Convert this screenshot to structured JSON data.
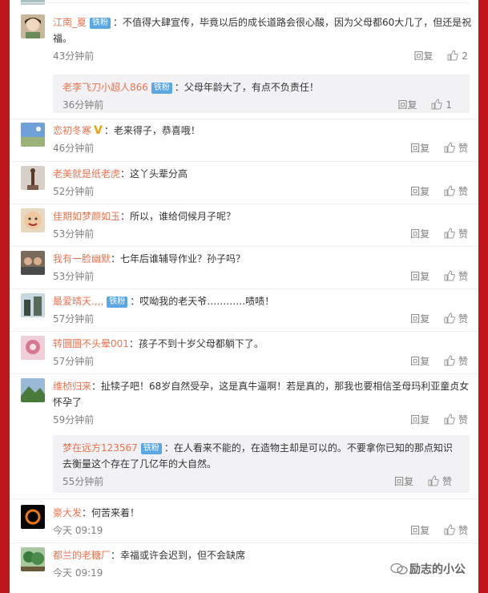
{
  "comments": [
    {
      "name": "江南_夏",
      "badge": "铁粉",
      "text": "：不值得大肆宣传，毕竟以后的成长道路会很心酸，因为父母都60大几了，但还是祝福。",
      "time": "43分钟前",
      "reply": "回复",
      "likes": "2",
      "avatar": "face-avatar",
      "sub": {
        "name": "老李飞刀小超人866",
        "badge": "铁粉",
        "text": "：父母年龄大了，有点不负责任！",
        "time": "36分钟前",
        "reply": "回复",
        "likes": "1"
      }
    },
    {
      "name": "恋初冬寒",
      "vip": "V",
      "text": "：老来得子，恭喜哦！",
      "time": "46分钟前",
      "reply": "回复",
      "likes": "赞",
      "avatar": "sky-avatar"
    },
    {
      "name": "老美就是纸老虎",
      "text": "：这丫头辈分高",
      "time": "52分钟前",
      "reply": "回复",
      "likes": "赞",
      "avatar": "statue-avatar"
    },
    {
      "name": "佳期如梦颜如玉",
      "text": "：所以，谁给伺候月子呢？",
      "time": "53分钟前",
      "reply": "回复",
      "likes": "赞",
      "avatar": "face2-avatar"
    },
    {
      "name": "我有一脸幽默",
      "text": "：七年后谁辅导作业？孙子吗？",
      "time": "53分钟前",
      "reply": "回复",
      "likes": "赞",
      "avatar": "group-avatar"
    },
    {
      "name": "最爱晴天.,,,",
      "badge": "铁粉",
      "text": "：哎呦我的老天爷…………啧啧！",
      "time": "57分钟前",
      "reply": "回复",
      "likes": "赞",
      "avatar": "tree-avatar"
    },
    {
      "name": "转圜圜不头晕001",
      "text": "：孩子不到十岁父母都躺下了。",
      "time": "57分钟前",
      "reply": "回复",
      "likes": "赞",
      "avatar": "pink-avatar"
    },
    {
      "name": "维桢归来",
      "text": "：扯犊子吧！68岁自然受孕，这是真牛逼啊！若是真的，那我也要相信圣母玛利亚童贞女怀孕了",
      "time": "59分钟前",
      "reply": "回复",
      "likes": "赞",
      "avatar": "mountain-avatar",
      "sub": {
        "name": "梦在远方123567",
        "badge": "铁粉",
        "text": "：在人看来不能的，在造物主却是可以的。不要拿你已知的那点知识去衡量这个存在了几亿年的大自然。",
        "time": "55分钟前",
        "reply": "回复",
        "likes": "赞"
      }
    },
    {
      "name": "豪大发",
      "text": "：何苦来着！",
      "time": "今天 09:19",
      "reply": "回复",
      "likes": "赞",
      "avatar": "blackhole-avatar"
    },
    {
      "name": "都兰的老糖厂",
      "text": "：幸福或许会迟到，但不会缺席",
      "time": "今天 09:19",
      "reply": "回复",
      "likes": "赞",
      "avatar": "forest-avatar"
    }
  ],
  "watermark": "励志的小公",
  "colors": {
    "background": "#c0161b",
    "name": "#eb7350",
    "badge": "#5ba7e4",
    "meta": "#808080"
  }
}
